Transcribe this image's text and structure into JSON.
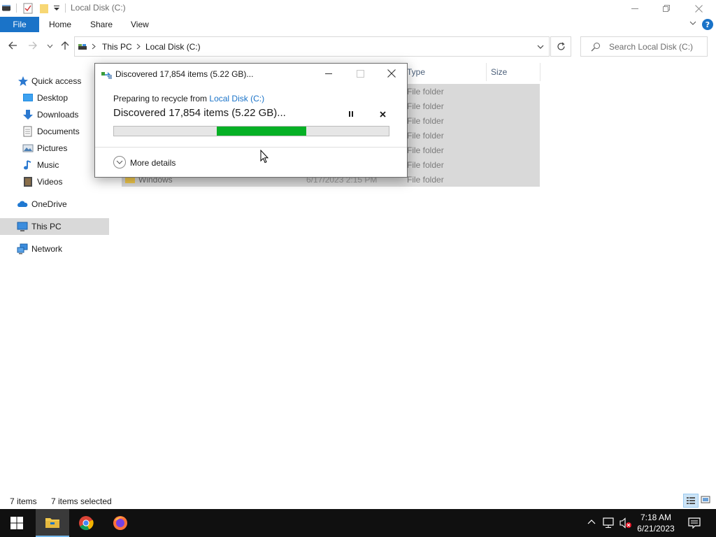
{
  "window": {
    "title": "Local Disk (C:)"
  },
  "ribbon": {
    "file": "File",
    "tabs": [
      "Home",
      "Share",
      "View"
    ]
  },
  "address": {
    "crumbs": [
      "This PC",
      "Local Disk (C:)"
    ],
    "search_placeholder": "Search Local Disk (C:)"
  },
  "nav": {
    "items": [
      {
        "label": "Quick access",
        "icon": "star-icon"
      },
      {
        "label": "Desktop",
        "icon": "desktop-folder-icon"
      },
      {
        "label": "Downloads",
        "icon": "download-arrow-icon"
      },
      {
        "label": "Documents",
        "icon": "documents-icon"
      },
      {
        "label": "Pictures",
        "icon": "pictures-icon"
      },
      {
        "label": "Music",
        "icon": "music-note-icon"
      },
      {
        "label": "Videos",
        "icon": "videos-icon"
      },
      {
        "label": "OneDrive",
        "icon": "cloud-icon"
      },
      {
        "label": "This PC",
        "icon": "computer-icon"
      },
      {
        "label": "Network",
        "icon": "network-icon"
      }
    ]
  },
  "columns": {
    "type": "Type",
    "size": "Size"
  },
  "files": {
    "rows": [
      {
        "name": "",
        "date": "",
        "type": "File folder"
      },
      {
        "name": "",
        "date": "",
        "type": "File folder"
      },
      {
        "name": "",
        "date": "",
        "type": "File folder"
      },
      {
        "name": "",
        "date": "",
        "type": "File folder"
      },
      {
        "name": "",
        "date": "",
        "type": "File folder"
      },
      {
        "name": "",
        "date": "",
        "type": "File folder"
      },
      {
        "name": "Windows",
        "date": "6/17/2023 2:15 PM",
        "type": "File folder"
      }
    ]
  },
  "status": {
    "count": "7 items",
    "selected": "7 items selected"
  },
  "dialog": {
    "title": "Discovered 17,854 items (5.22 GB)...",
    "preparing": "Preparing to recycle from ",
    "source_link": "Local Disk (C:)",
    "progress_text": "Discovered 17,854 items (5.22 GB)...",
    "progress_indeterminate": {
      "start": 0.375,
      "end": 0.7
    },
    "more_details": "More details",
    "colors": {
      "progress": "#06b025",
      "link": "#1a73c8"
    }
  },
  "taskbar": {
    "time": "7:18 AM",
    "date": "6/21/2023"
  }
}
